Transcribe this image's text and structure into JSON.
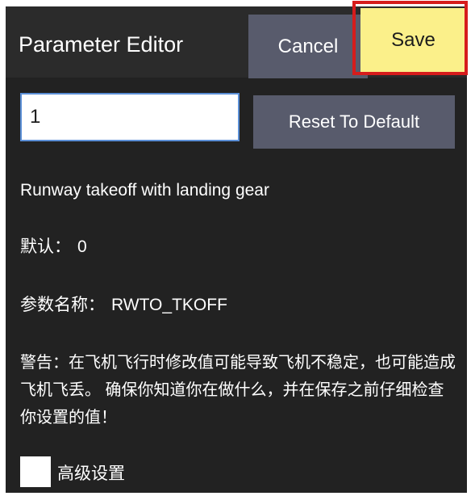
{
  "dialog": {
    "title": "Parameter Editor",
    "cancel_label": "Cancel",
    "save_label": "Save"
  },
  "editor": {
    "value": "1",
    "reset_label": "Reset To Default"
  },
  "info": {
    "description": "Runway takeoff with landing gear",
    "default_label": "默认：",
    "default_value": "0",
    "param_name_label": "参数名称：",
    "param_name_value": "RWTO_TKOFF",
    "warning": "警告：在飞机飞行时修改值可能导致飞机不稳定，也可能造成飞机飞丢。 确保你知道你在做什么，并在保存之前仔细检查你设置的值！"
  },
  "advanced": {
    "label": "高级设置",
    "checked": false
  },
  "colors": {
    "background": "#222222",
    "button": "#585b6c",
    "save_button": "#fbf08a",
    "highlight": "#d61c1c"
  }
}
